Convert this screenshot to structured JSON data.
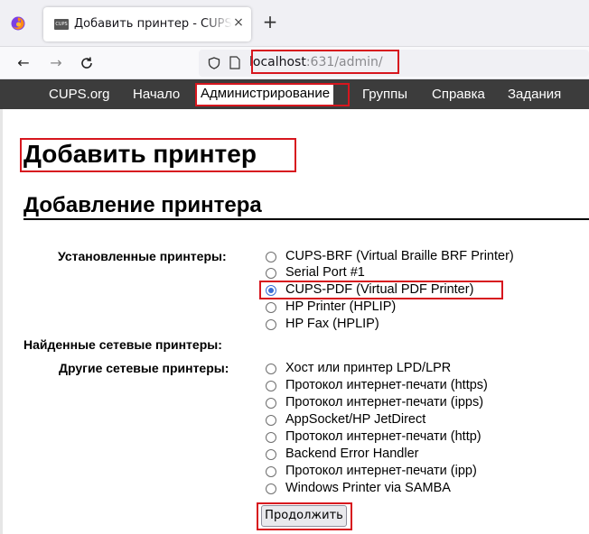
{
  "browser": {
    "tab_title": "Добавить принтер - CUPS",
    "tab_close": "×",
    "new_tab": "+",
    "nav_back": "←",
    "nav_forward": "→",
    "nav_reload": "C",
    "url_host": "localhost",
    "url_rest": ":631/admin/"
  },
  "header": {
    "links": [
      "CUPS.org",
      "Начало",
      "Администрирование",
      "Группы",
      "Справка",
      "Задания"
    ],
    "active": "Администрирование"
  },
  "page": {
    "title": "Добавить принтер",
    "section_title": "Добавление принтера",
    "installed_label": "Установленные принтеры:",
    "installed": [
      {
        "label": "CUPS-BRF (Virtual Braille BRF Printer)",
        "checked": false
      },
      {
        "label": "Serial Port #1",
        "checked": false
      },
      {
        "label": "CUPS-PDF (Virtual PDF Printer)",
        "checked": true
      },
      {
        "label": "HP Printer (HPLIP)",
        "checked": false
      },
      {
        "label": "HP Fax (HPLIP)",
        "checked": false
      }
    ],
    "found_label": "Найденные сетевые принтеры:",
    "other_label": "Другие сетевые принтеры:",
    "other": [
      {
        "label": "Хост или принтер LPD/LPR",
        "checked": false
      },
      {
        "label": "Протокол интернет-печати (https)",
        "checked": false
      },
      {
        "label": "Протокол интернет-печати (ipps)",
        "checked": false
      },
      {
        "label": "AppSocket/HP JetDirect",
        "checked": false
      },
      {
        "label": "Протокол интернет-печати (http)",
        "checked": false
      },
      {
        "label": "Backend Error Handler",
        "checked": false
      },
      {
        "label": "Протокол интернет-печати (ipp)",
        "checked": false
      },
      {
        "label": "Windows Printer via SAMBA",
        "checked": false
      }
    ],
    "continue_button": "Продолжить"
  },
  "colors": {
    "highlight": "#d7161e",
    "cups_header_bg": "#3c3c3c",
    "radio_checked": "#3b6fd6"
  }
}
